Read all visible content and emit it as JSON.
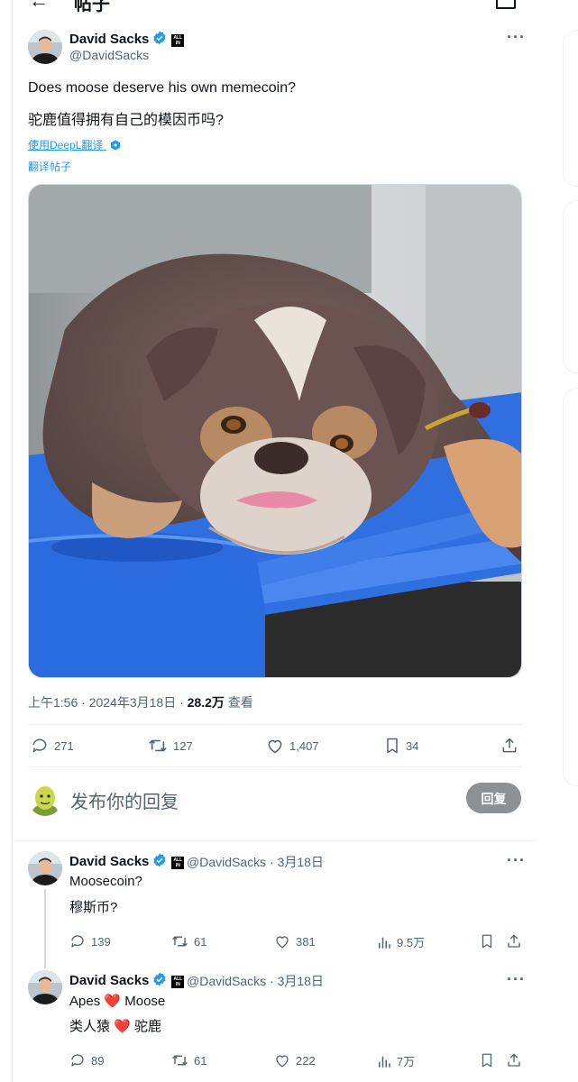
{
  "header": {
    "back": "←",
    "title": "帖子"
  },
  "post": {
    "author_name": "David Sacks",
    "author_handle": "@DavidSacks",
    "text_en": "Does moose deserve his own memecoin?",
    "text_zh": "驼鹿值得拥有自己的模因币吗?",
    "translate_deepl": "使用DeepL翻译",
    "translate_post": "翻译帖子",
    "meta_time": "上午1:56 · 2024年3月18日 · ",
    "meta_views": "28.2万",
    "meta_views_label": " 查看",
    "replies": "271",
    "reposts": "127",
    "likes": "1,407",
    "bookmarks": "34"
  },
  "composer": {
    "placeholder": "发布你的回复",
    "button": "回复"
  },
  "replies": [
    {
      "author_name": "David Sacks",
      "handle_date": "@DavidSacks · 3月18日",
      "text_en": "Moosecoin?",
      "text_zh": "穆斯币?",
      "replies": "139",
      "reposts": "61",
      "likes": "381",
      "views": "9.5万"
    },
    {
      "author_name": "David Sacks",
      "handle_date": "@DavidSacks · 3月18日",
      "text_en_a": "Apes",
      "text_en_heart": "❤️",
      "text_en_b": "Moose",
      "text_zh_a": "类人猿",
      "text_zh_heart": "❤️",
      "text_zh_b": "驼鹿",
      "replies": "89",
      "reposts": "61",
      "likes": "222",
      "views": "7万"
    }
  ],
  "colors": {
    "accent": "#1d9bf0",
    "heart": "#f91880",
    "muted": "#536471",
    "reply_button": "#8e9194"
  },
  "icons": [
    "back-arrow-icon",
    "verified-badge-icon",
    "all-in-badge-icon",
    "more-icon",
    "reply-icon",
    "repost-icon",
    "like-icon",
    "bookmark-icon",
    "share-icon",
    "views-icon",
    "deepl-icon"
  ]
}
